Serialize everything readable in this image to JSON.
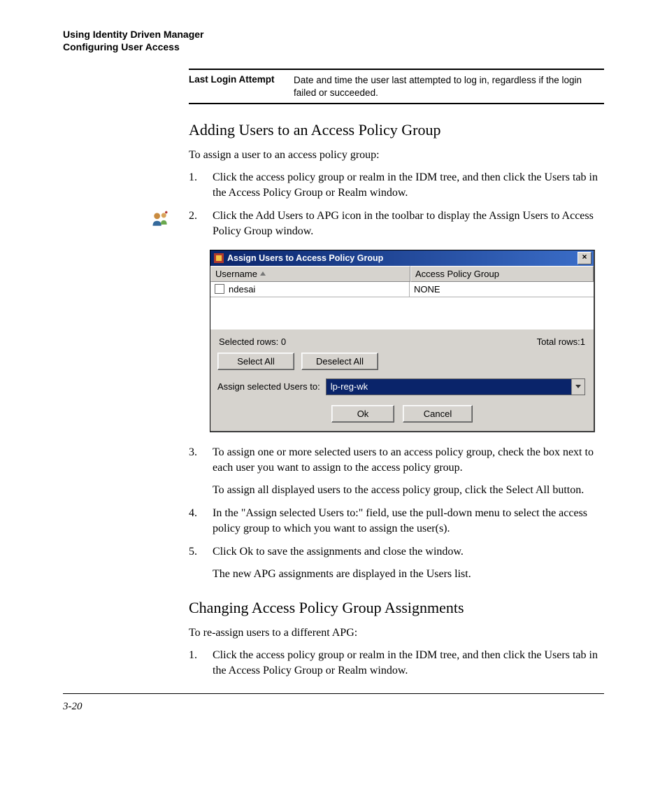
{
  "header": {
    "line1": "Using Identity Driven Manager",
    "line2": "Configuring User Access"
  },
  "attr": {
    "term": "Last Login Attempt",
    "desc": "Date and time the user last attempted to log in, regardless if the login failed or succeeded."
  },
  "section1": {
    "title": "Adding Users to an Access Policy Group",
    "intro": "To assign a user to an access policy group:",
    "steps": {
      "s1": "Click the access policy group or realm in the IDM tree, and then click the Users tab in the Access Policy Group or Realm window.",
      "s2": "Click the Add Users to APG icon in the toolbar to display the Assign Users to Access Policy Group window.",
      "s3a": "To assign one or more selected users to an access policy group, check the box next to each user you want to assign to the access policy group.",
      "s3b": "To assign all displayed users to the access policy group, click the Select All button.",
      "s4": "In the \"Assign selected Users to:\" field, use the pull-down menu to select the access policy group to which you want to assign the user(s).",
      "s5a": "Click Ok to save the assignments and close the window.",
      "s5b": "The new APG assignments are displayed in the Users list."
    }
  },
  "dialog": {
    "title": "Assign Users to Access Policy Group",
    "col_user": "Username",
    "col_apg": "Access Policy Group",
    "row_user": "ndesai",
    "row_apg": "NONE",
    "selected_rows": "Selected rows: 0",
    "total_rows": "Total rows:1",
    "btn_select_all": "Select All",
    "btn_deselect_all": "Deselect All",
    "assign_label": "Assign selected Users to:",
    "assign_value": "lp-reg-wk",
    "btn_ok": "Ok",
    "btn_cancel": "Cancel",
    "close_glyph": "×"
  },
  "section2": {
    "title": "Changing Access Policy Group Assignments",
    "intro": "To re-assign users to a different APG:",
    "steps": {
      "s1": "Click the access policy group or realm in the IDM tree, and then click the Users tab in the Access Policy Group or Realm window."
    }
  },
  "page_number": "3-20"
}
